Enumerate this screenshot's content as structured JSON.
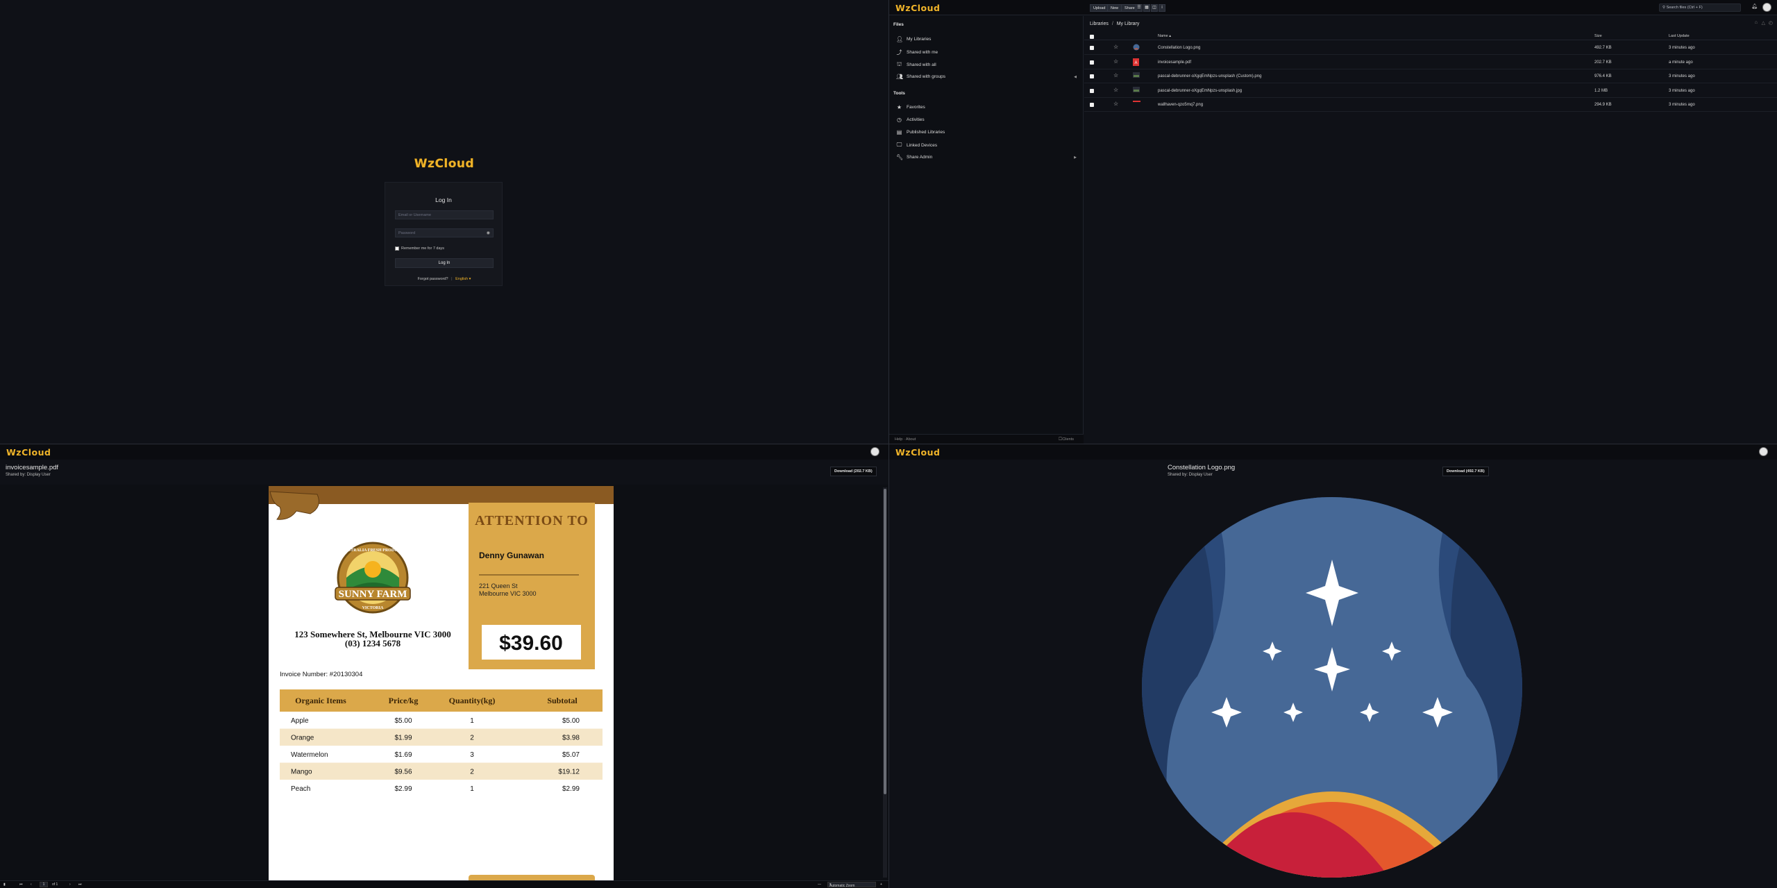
{
  "brand": "WzCloud",
  "login": {
    "title": "Log In",
    "email_placeholder": "Email or Username",
    "password_placeholder": "Password",
    "remember_label": "Remember me for 7 days",
    "submit_label": "Log In",
    "forgot_label": "Forgot password?",
    "separator": "|",
    "language_label": "English ▾"
  },
  "library": {
    "toolbar": {
      "upload": "Upload",
      "new": "New",
      "share": "Share"
    },
    "search_placeholder": "Search files (Ctrl + F)",
    "sidebar": {
      "files_heading": "Files",
      "items": [
        {
          "label": "My Libraries",
          "icon": "user-icon"
        },
        {
          "label": "Shared with me",
          "icon": "share-icon"
        },
        {
          "label": "Shared with all",
          "icon": "org-icon"
        },
        {
          "label": "Shared with groups",
          "icon": "group-icon"
        }
      ],
      "tools_heading": "Tools",
      "tools": [
        {
          "label": "Favorites",
          "icon": "star-icon"
        },
        {
          "label": "Activities",
          "icon": "clock-icon"
        },
        {
          "label": "Published Libraries",
          "icon": "document-icon"
        },
        {
          "label": "Linked Devices",
          "icon": "monitor-icon"
        },
        {
          "label": "Share Admin",
          "icon": "wrench-icon"
        }
      ],
      "footer_left": "Help · About",
      "footer_right": "Clients"
    },
    "breadcrumb": {
      "root": "Libraries",
      "sep": "/",
      "current": "My Library"
    },
    "columns": {
      "name": "Name ▴",
      "size": "Size",
      "updated": "Last Update"
    },
    "files": [
      {
        "name": "Constellation Logo.png",
        "size": "492.7 KB",
        "updated": "3 minutes ago",
        "icon": "image-thumb-icon"
      },
      {
        "name": "invoicesample.pdf",
        "size": "202.7 KB",
        "updated": "a minute ago",
        "icon": "pdf-icon"
      },
      {
        "name": "pascal-debrunner-oXgqEmNpzs-unsplash (Custom).png",
        "size": "976.4 KB",
        "updated": "3 minutes ago",
        "icon": "image-thumb-icon"
      },
      {
        "name": "pascal-debrunner-oXgqEmNpzs-unsplash.jpg",
        "size": "1.2 MB",
        "updated": "3 minutes ago",
        "icon": "image-thumb-icon"
      },
      {
        "name": "wallhaven-qzo5mq7.png",
        "size": "294.9 KB",
        "updated": "3 minutes ago",
        "icon": "image-thumb-icon"
      }
    ]
  },
  "pdf_viewer": {
    "file_name": "invoicesample.pdf",
    "shared_by": "Shared by: Display User",
    "download_label": "Download (202.7 KB)",
    "page_input": "1",
    "page_total": "of 1",
    "zoom": "Automatic Zoom",
    "invoice": {
      "attention_heading": "ATTENTION TO",
      "customer_name": "Denny Gunawan",
      "customer_address_1": "221 Queen St",
      "customer_address_2": "Melbourne VIC 3000",
      "total": "$39.60",
      "company_address": "123 Somewhere St, Melbourne VIC 3000",
      "company_phone": "(03) 1234 5678",
      "logo_ring_text": "AUSTRALIA FRESH PRODUCE",
      "logo_name": "SUNNY FARM",
      "logo_region": "VICTORIA",
      "invoice_number": "Invoice Number: #20130304",
      "table_headers": [
        "Organic Items",
        "Price/kg",
        "Quantity(kg)",
        "Subtotal"
      ],
      "rows": [
        [
          "Apple",
          "$5.00",
          "1",
          "$5.00"
        ],
        [
          "Orange",
          "$1.99",
          "2",
          "$3.98"
        ],
        [
          "Watermelon",
          "$1.69",
          "3",
          "$5.07"
        ],
        [
          "Mango",
          "$9.56",
          "2",
          "$19.12"
        ],
        [
          "Peach",
          "$2.99",
          "1",
          "$2.99"
        ]
      ]
    }
  },
  "image_viewer": {
    "file_name": "Constellation Logo.png",
    "shared_by": "Shared by: Display User",
    "download_label": "Download (492.7 KB)"
  },
  "colors": {
    "brand_gold": "#f0b429",
    "invoice_gold": "#dba84a",
    "invoice_brown": "#8a5a22",
    "logo_blue": "#466896",
    "logo_navy": "#2b4a7a",
    "logo_red": "#c8203a",
    "logo_orange": "#e4582c",
    "logo_yellow": "#e6a83a"
  }
}
